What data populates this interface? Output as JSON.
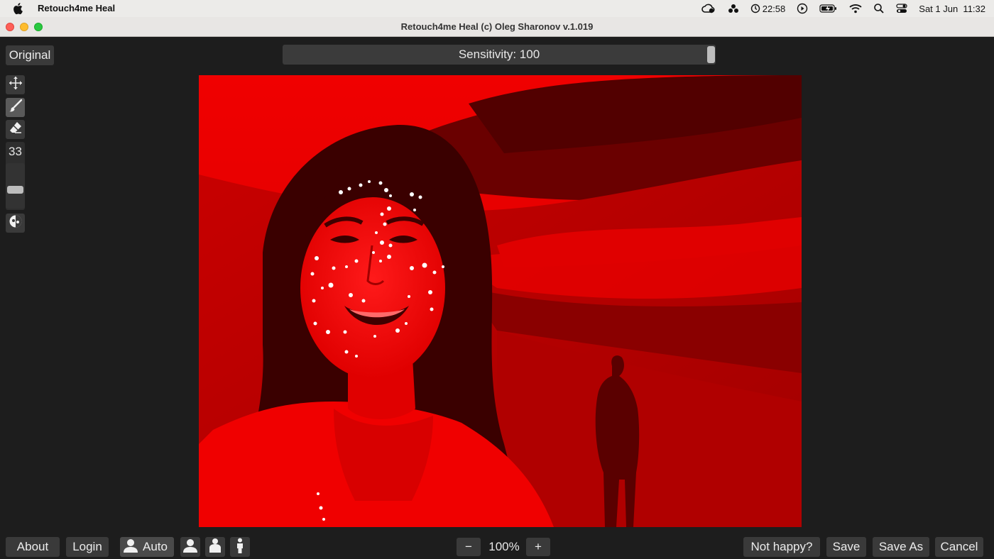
{
  "menubar": {
    "app_name": "Retouch4me Heal",
    "timer": "22:58",
    "datetime": "Sat 1 Jun  11:32",
    "icons": [
      "apple-icon",
      "creative-cloud-icon",
      "dropbox-icon",
      "timer-icon",
      "play-icon",
      "battery-icon",
      "wifi-icon",
      "spotlight-icon",
      "control-center-icon"
    ]
  },
  "window": {
    "title": "Retouch4me Heal (c) Oleg Sharonov v.1.019"
  },
  "toolbar": {
    "original_label": "Original",
    "sensitivity_label": "Sensitivity: 100",
    "sensitivity_value": 100
  },
  "tools": {
    "brush_size": "33",
    "brush_size_level": 0.4,
    "icons": [
      "move-icon",
      "brush-icon",
      "eraser-icon",
      "mask-toggle-icon"
    ]
  },
  "bottom": {
    "about_label": "About",
    "login_label": "Login",
    "auto_label": "Auto",
    "zoom_minus": "−",
    "zoom_value": "100%",
    "zoom_plus": "+",
    "not_happy_label": "Not happy?",
    "save_label": "Save",
    "save_as_label": "Save As",
    "cancel_label": "Cancel"
  },
  "colors": {
    "overlay_red": "#e00000",
    "background": "#1d1d1d",
    "button": "#3a3a3a"
  }
}
